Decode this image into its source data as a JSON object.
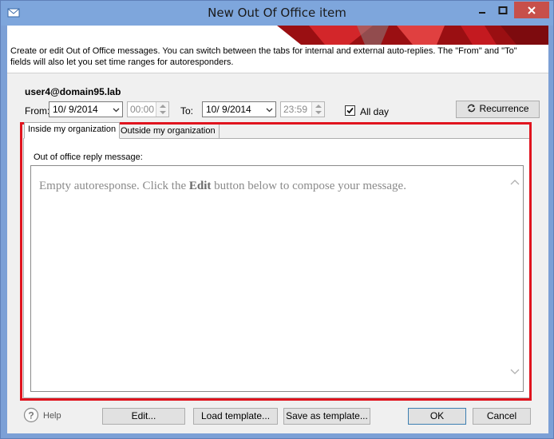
{
  "window": {
    "title": "New Out Of Office item"
  },
  "banner": {
    "description": "Create or edit Out of Office messages. You can switch between the tabs for internal and external auto-replies. The \"From\" and \"To\" fields will also let you set time ranges for autoresponders."
  },
  "user": "user4@domain95.lab",
  "from": {
    "label": "From:",
    "date": "10/ 9/2014",
    "time": "00:00"
  },
  "to": {
    "label": "To:",
    "date": "10/ 9/2014",
    "time": "23:59"
  },
  "all_day": {
    "label": "All day",
    "checked": true
  },
  "recurrence_button": "Recurrence",
  "tabs": [
    {
      "label": "Inside my organization",
      "active": true
    },
    {
      "label": "Outside my organization",
      "active": false
    }
  ],
  "panel": {
    "label": "Out of office reply message:",
    "empty_prefix": "Empty autoresponse. Click the ",
    "empty_bold": "Edit",
    "empty_suffix": " button below to compose your message."
  },
  "footer": {
    "help": "Help",
    "edit": "Edit...",
    "load_template": "Load template...",
    "save_as_template": "Save as template...",
    "ok": "OK",
    "cancel": "Cancel"
  },
  "colors": {
    "titlebar": "#7ea6dc",
    "close_button": "#c7504a",
    "highlight": "#e0141e"
  },
  "icons": [
    "app-icon",
    "minimize-icon",
    "maximize-icon",
    "close-icon",
    "chevron-down-icon",
    "recurrence-icon",
    "checkmark-icon",
    "help-icon",
    "chevron-up-icon"
  ]
}
